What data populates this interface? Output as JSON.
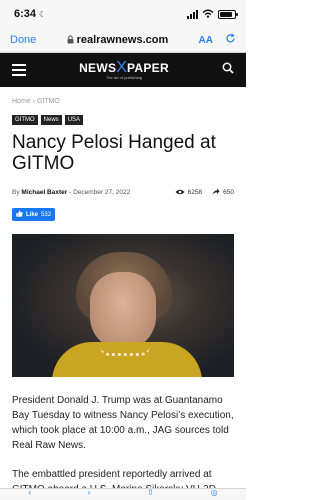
{
  "status_bar": {
    "time": "6:34"
  },
  "browser": {
    "done_label": "Done",
    "url": "realrawnews.com",
    "text_size_label": "AA"
  },
  "site": {
    "logo_left": "NEWS",
    "logo_x": "X",
    "logo_right": "PAPER",
    "tagline": "The art of publishing"
  },
  "breadcrumb": [
    "Home",
    "GITMO"
  ],
  "tags": [
    "GITMO",
    "News",
    "USA"
  ],
  "article": {
    "title": "Nancy Pelosi Hanged at GITMO",
    "by_label": "By",
    "author": "Michael Baxter",
    "date": "December 27, 2022",
    "views": "6258",
    "shares": "650",
    "like_label": "Like",
    "like_count": "532",
    "paragraphs": [
      "President Donald J. Trump was at Guantanamo Bay Tuesday to witness Nancy Pelosi’s execution, which took place at 10:00 a.m., JAG sources told Real Raw News.",
      "The embattled president reportedly arrived at GITMO aboard a U.S. Marine Sikorsky VH-3D"
    ]
  },
  "colors": {
    "header_bg": "#111111",
    "accent_blue": "#2f80ed",
    "facebook_blue": "#1877f2"
  },
  "icons": [
    "moon-icon",
    "signal-icon",
    "wifi-icon",
    "battery-icon",
    "lock-icon",
    "refresh-icon",
    "menu-icon",
    "search-icon",
    "eye-icon",
    "share-icon",
    "like-thumb-icon"
  ]
}
